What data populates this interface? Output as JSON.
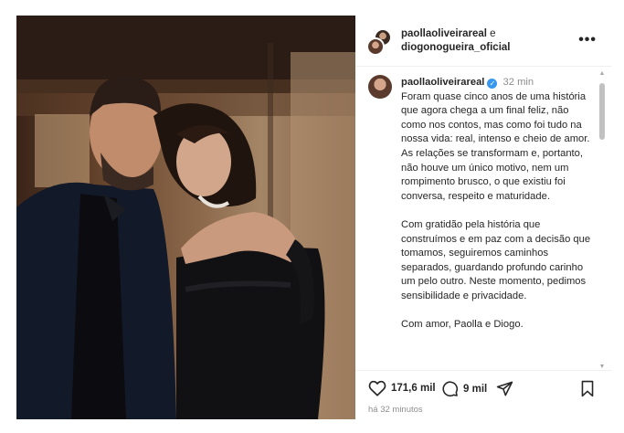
{
  "header": {
    "user1": "paollaoliveirareal",
    "conjunction": " e",
    "user2": "diogonogueira_oficial",
    "more_icon": "more-horizontal-icon"
  },
  "caption": {
    "username": "paollaoliveirareal",
    "time": "32 min",
    "paragraphs": [
      "Foram quase cinco anos de uma história que agora chega a um final feliz, não como nos contos, mas como foi tudo na nossa vida: real, intenso e cheio de amor. As relações se transformam e, portanto, não houve um único motivo, nem um rompimento brusco, o que existiu foi conversa, respeito e maturidade.",
      "Com gratidão pela história que construímos e em paz com a decisão que tomamos, seguiremos caminhos separados, guardando profundo carinho um pelo outro. Neste momento, pedimos sensibilidade e privacidade.",
      "Com amor, Paolla e Diogo."
    ]
  },
  "actions": {
    "likes": "171,6 mil",
    "comments": "9 mil",
    "like_icon": "heart-icon",
    "comment_icon": "comment-bubble-icon",
    "share_icon": "paper-plane-icon",
    "save_icon": "bookmark-icon",
    "posted_ago": "há 32 minutos"
  },
  "colors": {
    "verified": "#3897f0",
    "muted": "#8e8e8e",
    "text": "#262626"
  }
}
